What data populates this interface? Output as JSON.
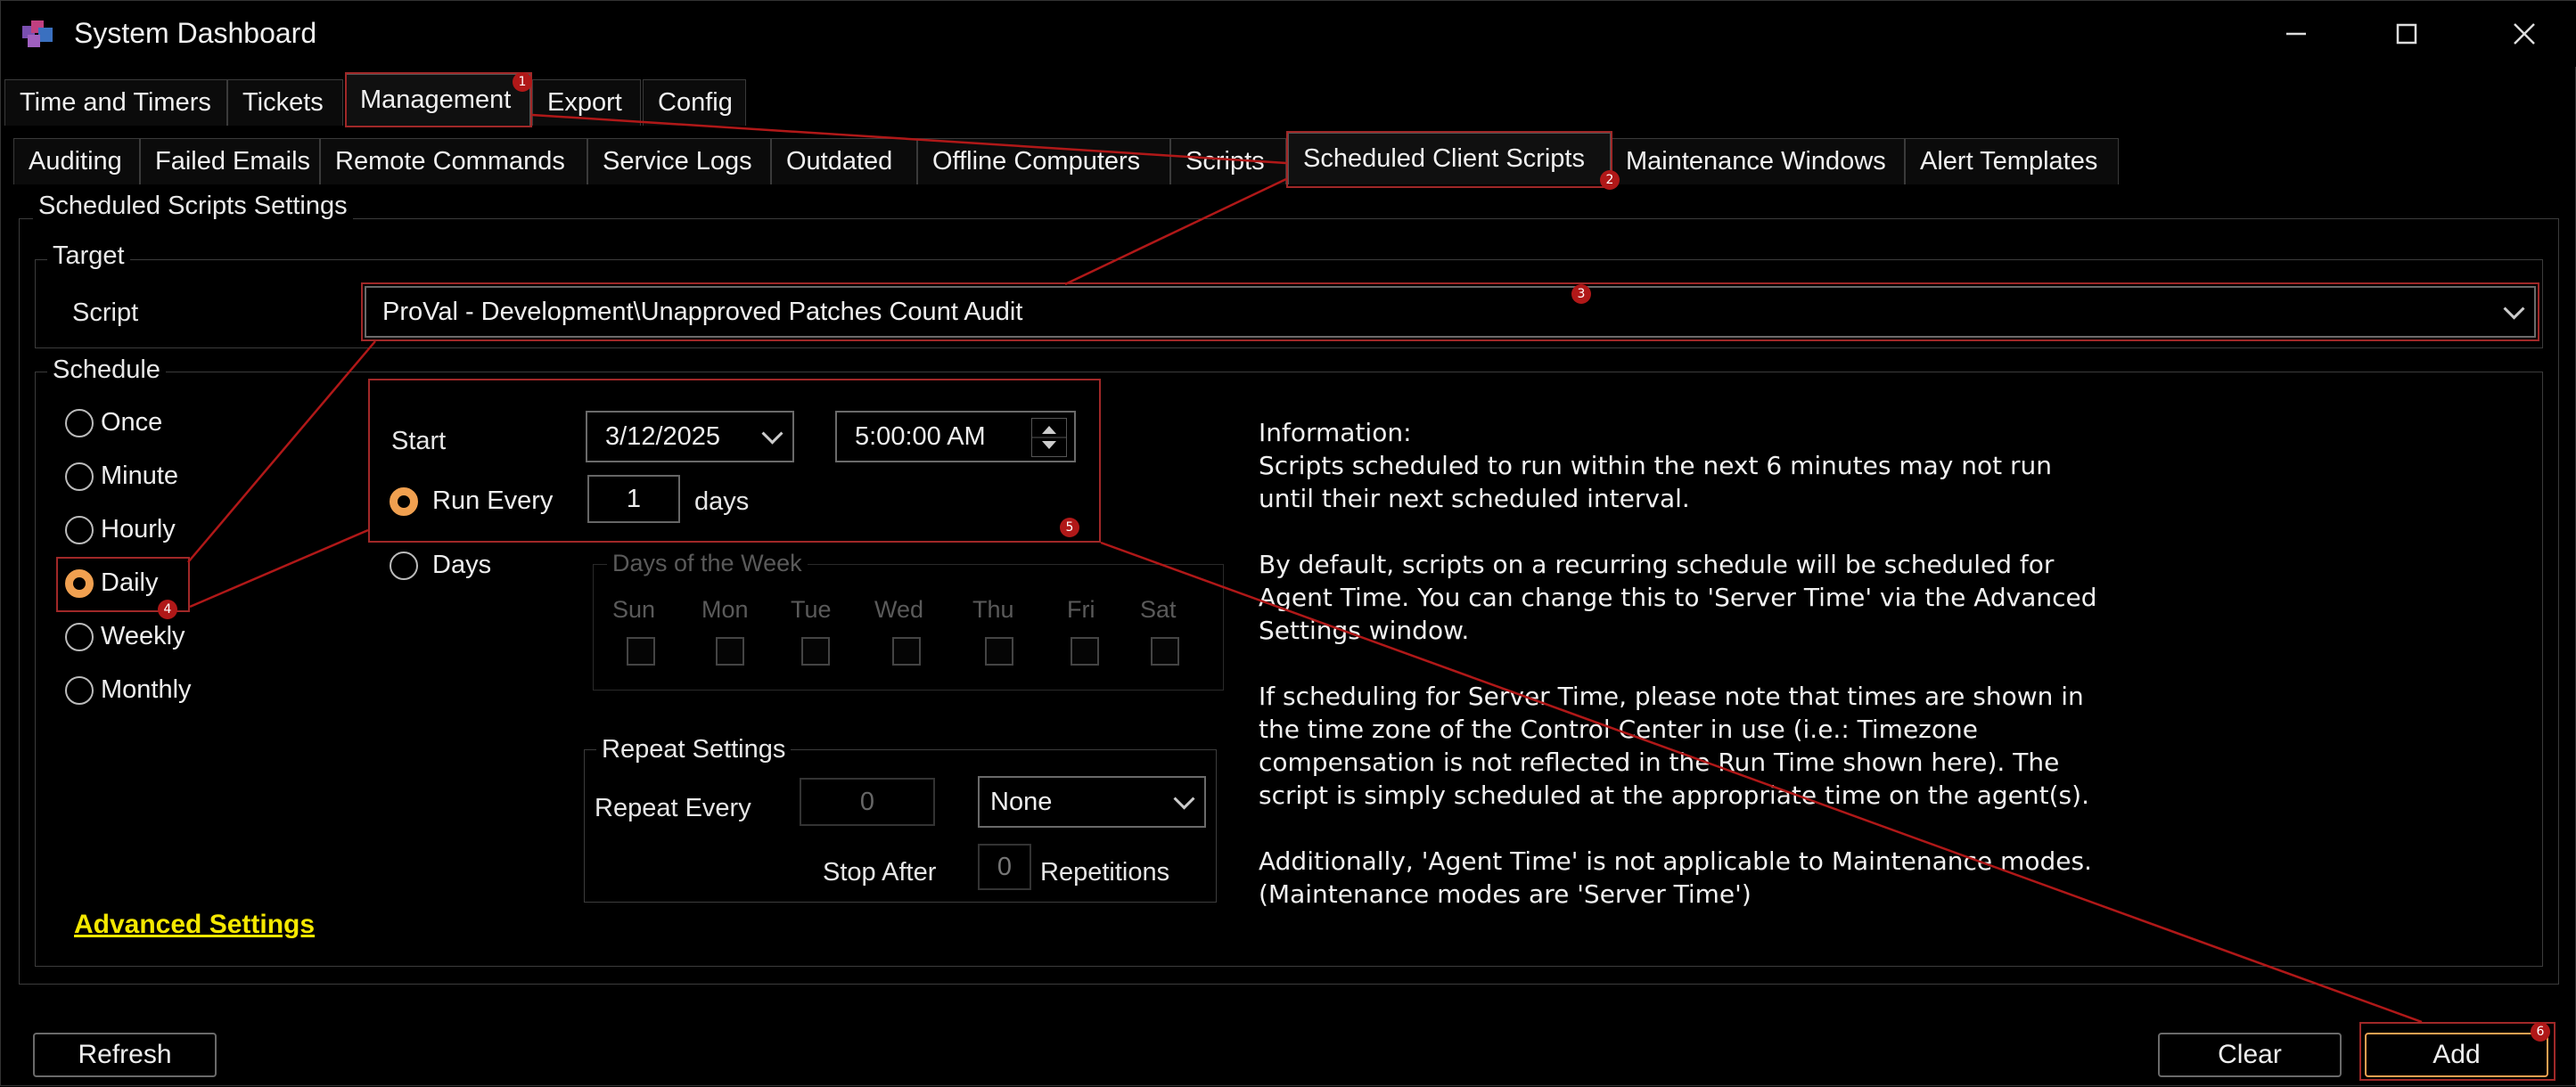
{
  "window": {
    "title": "System Dashboard"
  },
  "main_tabs": [
    "Time and Timers",
    "Tickets",
    "Management",
    "Export",
    "Config"
  ],
  "sub_tabs": [
    "Auditing",
    "Failed Emails",
    "Remote Commands",
    "Service Logs",
    "Outdated",
    "Offline Computers",
    "Scripts",
    "Scheduled Client Scripts",
    "Maintenance Windows",
    "Alert Templates"
  ],
  "settings": {
    "group_title": "Scheduled Scripts Settings",
    "target": {
      "label": "Target",
      "script_label": "Script",
      "script_value": "ProVal - Development\\Unapproved Patches Count Audit"
    },
    "schedule": {
      "label": "Schedule",
      "options": [
        "Once",
        "Minute",
        "Hourly",
        "Daily",
        "Weekly",
        "Monthly"
      ],
      "selected": "Daily"
    },
    "daily": {
      "start_label": "Start",
      "start_date": "3/12/2025",
      "start_time": "5:00:00 AM",
      "run_every_label": "Run Every",
      "run_every_value": "1",
      "run_every_unit": "days",
      "days_label": "Days",
      "dow_label": "Days of the Week",
      "dow": [
        "Sun",
        "Mon",
        "Tue",
        "Wed",
        "Thu",
        "Fri",
        "Sat"
      ]
    },
    "repeat": {
      "label": "Repeat Settings",
      "repeat_every_label": "Repeat Every",
      "repeat_every_value": "0",
      "repeat_unit": "None",
      "stop_after_label": "Stop After",
      "stop_after_value": "0",
      "repetitions_label": "Repetitions"
    },
    "info": [
      "Information:\nScripts scheduled to run within the next 6 minutes may not run until their next scheduled interval.",
      "By default, scripts on a recurring schedule will be scheduled for Agent Time. You can change this to 'Server Time' via the Advanced Settings window.",
      "If scheduling for Server Time, please note that times are shown in the time zone of the Control Center in use (i.e.: Timezone compensation is not reflected in the Run Time shown here). The script is simply scheduled at the appropriate time on the agent(s).",
      "Additionally, 'Agent Time' is not applicable to Maintenance modes. (Maintenance modes are 'Server Time')"
    ],
    "advanced_link": "Advanced Settings"
  },
  "buttons": {
    "refresh": "Refresh",
    "clear": "Clear",
    "add": "Add"
  },
  "annotations": [
    "1",
    "2",
    "3",
    "4",
    "5",
    "6"
  ],
  "colors": {
    "accent": "#f0a050",
    "annotation": "#b01818",
    "link": "#f5e800",
    "background": "#000000"
  }
}
